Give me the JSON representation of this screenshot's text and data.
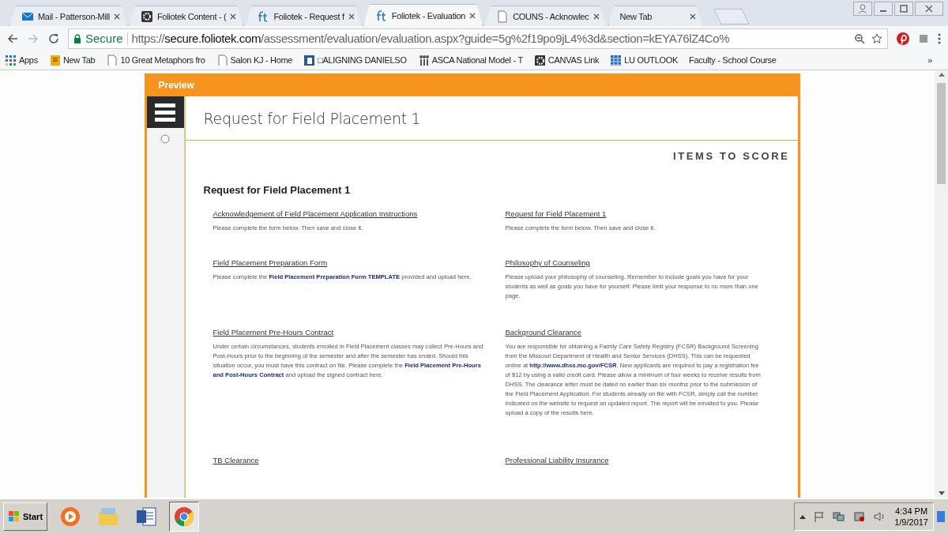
{
  "browser": {
    "tabs": [
      {
        "title": "Mail - Patterson-Mill",
        "kind": "mail",
        "selected": false
      },
      {
        "title": "Foliotek Content - (",
        "kind": "badge",
        "selected": false
      },
      {
        "title": "Foliotek - Request f",
        "kind": "ft",
        "selected": false
      },
      {
        "title": "Foliotek - Evaluation",
        "kind": "ft",
        "selected": true
      },
      {
        "title": "COUNS - Acknowlec",
        "kind": "page",
        "selected": false
      },
      {
        "title": "New Tab",
        "kind": "plain",
        "selected": false
      }
    ],
    "secure_label": "Secure",
    "url": "https://**secure.foliotek.com**/assessment/evaluation/evaluation.aspx?guide=5g%2f19po9jL4%3d&section=kEYA76lZ4Co%",
    "bookmarks": [
      {
        "label": "Apps",
        "kind": "apps"
      },
      {
        "label": "New Tab",
        "kind": "ribbon"
      },
      {
        "label": "10 Great Metaphors fro",
        "kind": "page"
      },
      {
        "label": "Salon KJ - Home",
        "kind": "page"
      },
      {
        "label": "□ALIGNING DANIELSO",
        "kind": "square"
      },
      {
        "label": "ASCA National Model - T",
        "kind": "people"
      },
      {
        "label": "CANVAS Link",
        "kind": "badge"
      },
      {
        "label": "LU OUTLOOK",
        "kind": "grid"
      },
      {
        "label": "Faculty - School Course",
        "kind": "plain"
      }
    ],
    "bookmarks_overflow": "»"
  },
  "page": {
    "header": "Preview",
    "title": "Request for Field Placement 1",
    "items_heading": "ITEMS TO SCORE",
    "section_title": "Request for Field Placement 1",
    "items": [
      {
        "title": "Acknowledgement of Field Placement Application Instructions",
        "description": "Please complete the form below. Then save and close it."
      },
      {
        "title": "Request for Field Placement 1",
        "description": "Please complete the form below. Then save and close it."
      },
      {
        "title": "Field Placement Preparation Form",
        "description": "Please complete the **Field Placement Preparation Form TEMPLATE** provided and upload here."
      },
      {
        "title": "Philosophy of Counseling",
        "description": "Please upload your philosophy of counseling. Remember to include goals you have for your students as well as goals you have for yourself. Please limit your response to no more than one page."
      },
      {
        "title": "Field Placement Pre-Hours Contract",
        "description": "Under certain circumstances, students enrolled in Field Placement classes may collect Pre-Hours and Post-Hours prior to the beginning of the semester and after the semester has ended. Should this situation occur, you must have this contract on file. Please complete the **Field Placement Pre-Hours and Post-Hours Contract** and upload the signed contract here."
      },
      {
        "title": "Background Clearance",
        "description": "You are responsible for obtaining a Family Care Safety Registry (FCSR) Background Screening from the Missouri Department of Health and Senior Services (DHSS). This can be requested online at **http://www.dhss.mo.gov/FCSR**. New applicants are required to pay a registration fee of $12 by using a valid credit card. Please allow a minimum of four weeks to receive results from DHSS. The clearance letter must be dated no earlier than six months prior to the submission of the Field Placement Application. For students already on file with FCSR, simply call the number indicated on the website to request an updated report. The report will be emailed to you. Please upload a copy of the results here."
      },
      {
        "title": "TB Clearance"
      },
      {
        "title": "Professional Liability Insurance"
      }
    ]
  },
  "taskbar": {
    "start": "Start",
    "apps": [
      {
        "kind": "media",
        "selected": false
      },
      {
        "kind": "folder",
        "selected": false
      },
      {
        "kind": "word",
        "selected": false
      },
      {
        "kind": "chrome",
        "selected": true
      }
    ],
    "time": "4:34 PM",
    "date": "1/9/2017"
  }
}
